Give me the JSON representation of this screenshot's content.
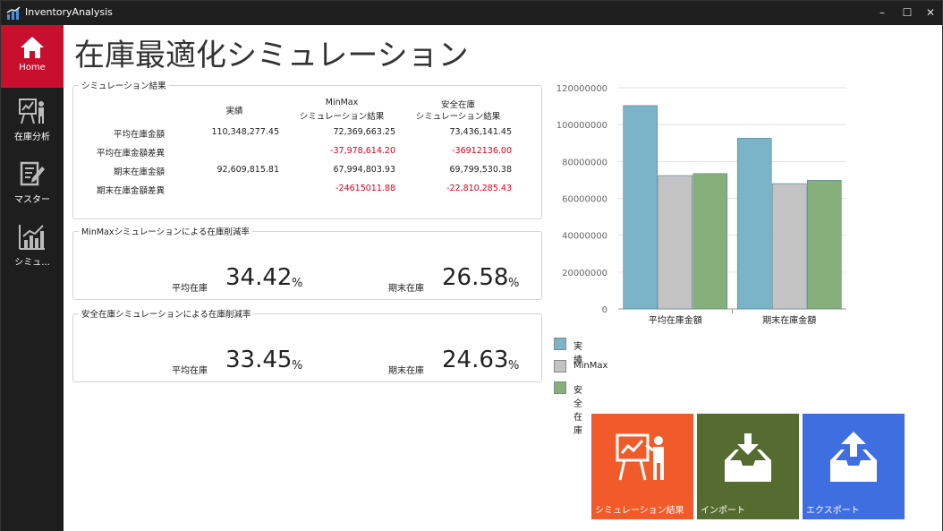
{
  "window": {
    "title": "InventoryAnalysis"
  },
  "sidebar": {
    "items": [
      {
        "label": "Home",
        "icon": "home-icon",
        "active": true
      },
      {
        "label": "在庫分析",
        "icon": "presentation-icon",
        "active": false
      },
      {
        "label": "マスター",
        "icon": "edit-document-icon",
        "active": false
      },
      {
        "label": "シミュ...",
        "icon": "bar-chart-icon",
        "active": false
      }
    ]
  },
  "page": {
    "title": "在庫最適化シミュレーション"
  },
  "results": {
    "group_title": "シミュレーション結果",
    "headers": [
      "実績",
      "MinMax\nシミュレーション結果",
      "安全在庫\nシミュレーション結果"
    ],
    "header_lines": {
      "actual": "実績",
      "minmax_1": "MinMax",
      "minmax_2": "シミュレーション結果",
      "safety_1": "安全在庫",
      "safety_2": "シミュレーション結果"
    },
    "rows": [
      {
        "label": "平均在庫金額",
        "actual": "110,348,277.45",
        "minmax": "72,369,663.25",
        "safety": "73,436,141.45"
      },
      {
        "label": "平均在庫金額差異",
        "actual": "",
        "minmax": "-37,978,614.20",
        "safety": "-36912136.00"
      },
      {
        "label": "期末在庫金額",
        "actual": "92,609,815.81",
        "minmax": "67,994,803.93",
        "safety": "69,799,530.38"
      },
      {
        "label": "期末在庫金額差異",
        "actual": "",
        "minmax": "-24615011.88",
        "safety": "-22,810,285.43"
      }
    ]
  },
  "minmax_reduction": {
    "group_title": "MinMaxシミュレーションによる在庫削減率",
    "avg_label": "平均在庫",
    "avg_value": "34.42",
    "avg_unit": "%",
    "end_label": "期末在庫",
    "end_value": "26.58",
    "end_unit": "%"
  },
  "safety_reduction": {
    "group_title": "安全在庫シミュレーションによる在庫削減率",
    "avg_label": "平均在庫",
    "avg_value": "33.45",
    "avg_unit": "%",
    "end_label": "期末在庫",
    "end_value": "24.63",
    "end_unit": "%"
  },
  "chart_data": {
    "type": "bar",
    "categories": [
      "平均在庫金額",
      "期末在庫金額"
    ],
    "series": [
      {
        "name": "実績",
        "values": [
          110348277.45,
          92609815.81
        ],
        "color": "#7bb3c8"
      },
      {
        "name": "MinMax",
        "values": [
          72369663.25,
          67994803.93
        ],
        "color": "#c3c3c3"
      },
      {
        "name": "安全在庫",
        "values": [
          73436141.45,
          69799530.38
        ],
        "color": "#86b07b"
      }
    ],
    "ylim": [
      0,
      120000000
    ],
    "yticks": [
      "0",
      "20000000",
      "40000000",
      "60000000",
      "80000000",
      "100000000",
      "120000000"
    ],
    "grid": true,
    "legend": "bottom-left"
  },
  "tiles": [
    {
      "label": "シミュレーション結果",
      "icon": "presentation-icon",
      "color": "#f15a29"
    },
    {
      "label": "インポート",
      "icon": "import-icon",
      "color": "#556b2f"
    },
    {
      "label": "エクスポート",
      "icon": "export-icon",
      "color": "#3f6ee0"
    }
  ]
}
